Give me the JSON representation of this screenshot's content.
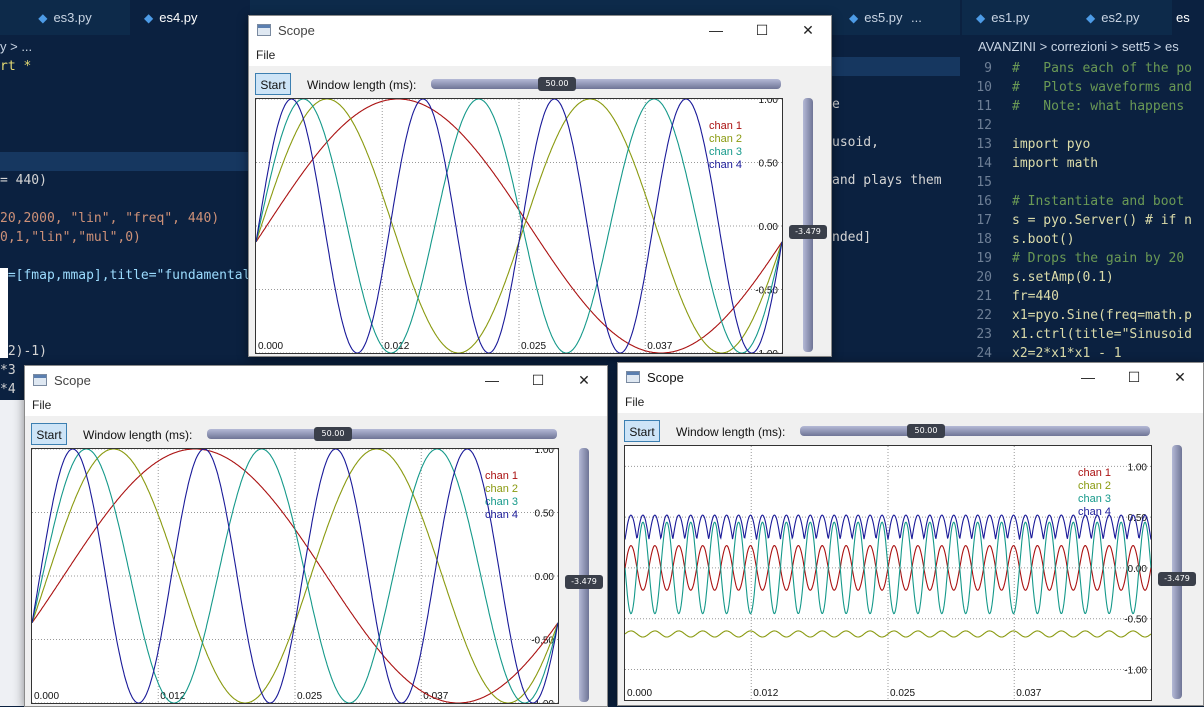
{
  "editor_left": {
    "tabs": [
      {
        "label": "es3.py",
        "active": false
      },
      {
        "label": "es4.py",
        "active": true
      }
    ],
    "breadcrumb": "y > ...",
    "code_lines": [
      "rt *",
      "",
      "",
      "",
      "",
      "",
      "= 440)",
      "",
      "20,2000, \"lin\", \"freq\", 440)",
      "0,1,\"lin\",\"mul\",0)",
      "",
      "t=[fmap,mmap],title=\"fundamental",
      "",
      "",
      "",
      "*2)-1)",
      "*3",
      "*4"
    ]
  },
  "editor_middle": {
    "tabs": [
      {
        "label": "es5.py",
        "active": false
      },
      {
        "label": "...",
        "active": false
      }
    ],
    "code_fragments": [
      "e",
      "usoid,",
      "and plays them",
      "nded]"
    ]
  },
  "editor_right": {
    "tabs": [
      {
        "label": "es1.py",
        "active": false
      },
      {
        "label": "es2.py",
        "active": false
      },
      {
        "label": "es",
        "active": false
      }
    ],
    "breadcrumb": "AVANZINI > correzioni > sett5 > es",
    "lines": [
      {
        "n": "9",
        "text": "#   Pans each of the po"
      },
      {
        "n": "10",
        "text": "#   Plots waveforms and"
      },
      {
        "n": "11",
        "text": "#   Note: what happens"
      },
      {
        "n": "12",
        "text": ""
      },
      {
        "n": "13",
        "text": "import pyo"
      },
      {
        "n": "14",
        "text": "import math"
      },
      {
        "n": "15",
        "text": ""
      },
      {
        "n": "16",
        "text": "# Instantiate and boot"
      },
      {
        "n": "17",
        "text": "s = pyo.Server() # if n"
      },
      {
        "n": "18",
        "text": "s.boot()"
      },
      {
        "n": "19",
        "text": "# Drops the gain by 20"
      },
      {
        "n": "20",
        "text": "s.setAmp(0.1)"
      },
      {
        "n": "21",
        "text": "fr=440"
      },
      {
        "n": "22",
        "text": "x1=pyo.Sine(freq=math.p"
      },
      {
        "n": "23",
        "text": "x1.ctrl(title=\"Sinusoid"
      },
      {
        "n": "24",
        "text": "x2=2*x1*x1 - 1"
      }
    ]
  },
  "scopes": [
    {
      "title": "Scope",
      "menu_file": "File",
      "start_label": "Start",
      "window_length_label": "Window length (ms):",
      "window_length_value": "50.00",
      "gain_value": "-3.479",
      "gain_level": 0.47,
      "x_ticks": [
        "0.000",
        "0.012",
        "0.025",
        "0.037"
      ],
      "y_ticks": [
        "1.00",
        "0.50",
        "0.00",
        "-0.50",
        "-1.00"
      ],
      "legend": [
        "chan 1",
        "chan 2",
        "chan 3",
        "chan 4"
      ],
      "controls": {
        "minimize": "—",
        "maximize": "☐",
        "close": "✕"
      }
    },
    {
      "title": "Scope",
      "menu_file": "File",
      "start_label": "Start",
      "window_length_label": "Window length (ms):",
      "window_length_value": "50.00",
      "gain_value": "-3.479",
      "gain_level": 0.47,
      "x_ticks": [
        "0.000",
        "0.012",
        "0.025",
        "0.037"
      ],
      "y_ticks": [
        "1.00",
        "0.50",
        "0.00",
        "-0.50",
        "-1.00"
      ],
      "legend": [
        "chan 1",
        "chan 2",
        "chan 3",
        "chan 4"
      ],
      "controls": {
        "minimize": "—",
        "maximize": "☐",
        "close": "✕"
      }
    },
    {
      "title": "Scope",
      "menu_file": "File",
      "start_label": "Start",
      "window_length_label": "Window length (ms):",
      "window_length_value": "50.00",
      "gain_value": "-3.479",
      "gain_level": 0.47,
      "x_ticks": [
        "0.000",
        "0.012",
        "0.025",
        "0.037"
      ],
      "y_ticks": [
        "1.00",
        "0.50",
        "0.00",
        "-0.50",
        "-1.00"
      ],
      "legend": [
        "chan 1",
        "chan 2",
        "chan 3",
        "chan 4"
      ],
      "controls": {
        "minimize": "—",
        "maximize": "☐",
        "close": "✕"
      }
    }
  ],
  "chart_data": [
    {
      "type": "line",
      "x_range": [
        0.0,
        0.05
      ],
      "ylim": [
        -1.0,
        1.0
      ],
      "x_ticks": [
        0.0,
        0.012,
        0.025,
        0.037
      ],
      "y_ticks": [
        1.0,
        0.5,
        0.0,
        -0.5,
        -1.0
      ],
      "grid": true,
      "legend": "top-right",
      "series": [
        {
          "name": "chan 1",
          "color": "#aa1111",
          "kind": "cos",
          "cycles": 1,
          "offset": 0,
          "amp": 1,
          "phase": 0.27
        },
        {
          "name": "chan 2",
          "color": "#8a9a10",
          "kind": "cos",
          "cycles": 2,
          "offset": 0,
          "amp": 1,
          "phase": 0.27
        },
        {
          "name": "chan 3",
          "color": "#15998a",
          "kind": "cos",
          "cycles": 3,
          "offset": 0,
          "amp": 1,
          "phase": 0.27
        },
        {
          "name": "chan 4",
          "color": "#1a1a99",
          "kind": "cos",
          "cycles": 4,
          "offset": 0,
          "amp": 1,
          "phase": 0.27
        }
      ]
    },
    {
      "type": "line",
      "x_range": [
        0.0,
        0.05
      ],
      "ylim": [
        -1.0,
        1.0
      ],
      "x_ticks": [
        0.0,
        0.012,
        0.025,
        0.037
      ],
      "y_ticks": [
        1.0,
        0.5,
        0.0,
        -0.5,
        -1.0
      ],
      "grid": true,
      "legend": "top-right",
      "series": [
        {
          "name": "chan 1",
          "color": "#aa1111",
          "kind": "cos",
          "cycles": 1,
          "offset": 0,
          "amp": 1,
          "phase": 0.31
        },
        {
          "name": "chan 2",
          "color": "#8a9a10",
          "kind": "cos",
          "cycles": 2,
          "offset": 0,
          "amp": 1,
          "phase": 0.31
        },
        {
          "name": "chan 3",
          "color": "#15998a",
          "kind": "cos",
          "cycles": 3,
          "offset": 0,
          "amp": 1,
          "phase": 0.31
        },
        {
          "name": "chan 4",
          "color": "#1a1a99",
          "kind": "cos",
          "cycles": 4,
          "offset": 0,
          "amp": 1,
          "phase": 0.31
        }
      ]
    },
    {
      "type": "line",
      "x_range": [
        0.0,
        0.05
      ],
      "ylim": [
        -1.3,
        1.2
      ],
      "x_ticks": [
        0.0,
        0.012,
        0.025,
        0.037
      ],
      "y_ticks": [
        1.0,
        0.5,
        0.0,
        -0.5,
        -1.0
      ],
      "grid": true,
      "legend": "top-right",
      "series": [
        {
          "name": "chan 1",
          "color": "#aa1111",
          "kind": "sin",
          "cycles": 22,
          "offset": 0.0,
          "amp": 0.22,
          "phase": 0.0
        },
        {
          "name": "chan 2",
          "color": "#8a9a10",
          "kind": "sin",
          "cycles": 22,
          "offset": -0.65,
          "amp": 0.03,
          "phase": 0.0
        },
        {
          "name": "chan 3",
          "color": "#15998a",
          "kind": "sin",
          "cycles": 22,
          "offset": 0.0,
          "amp": 0.45,
          "phase": 0.5
        },
        {
          "name": "chan 4",
          "color": "#1a1a99",
          "kind": "abs",
          "cycles": 22,
          "offset": 0.4,
          "amp": 0.12,
          "phase": 0.0
        }
      ]
    }
  ]
}
